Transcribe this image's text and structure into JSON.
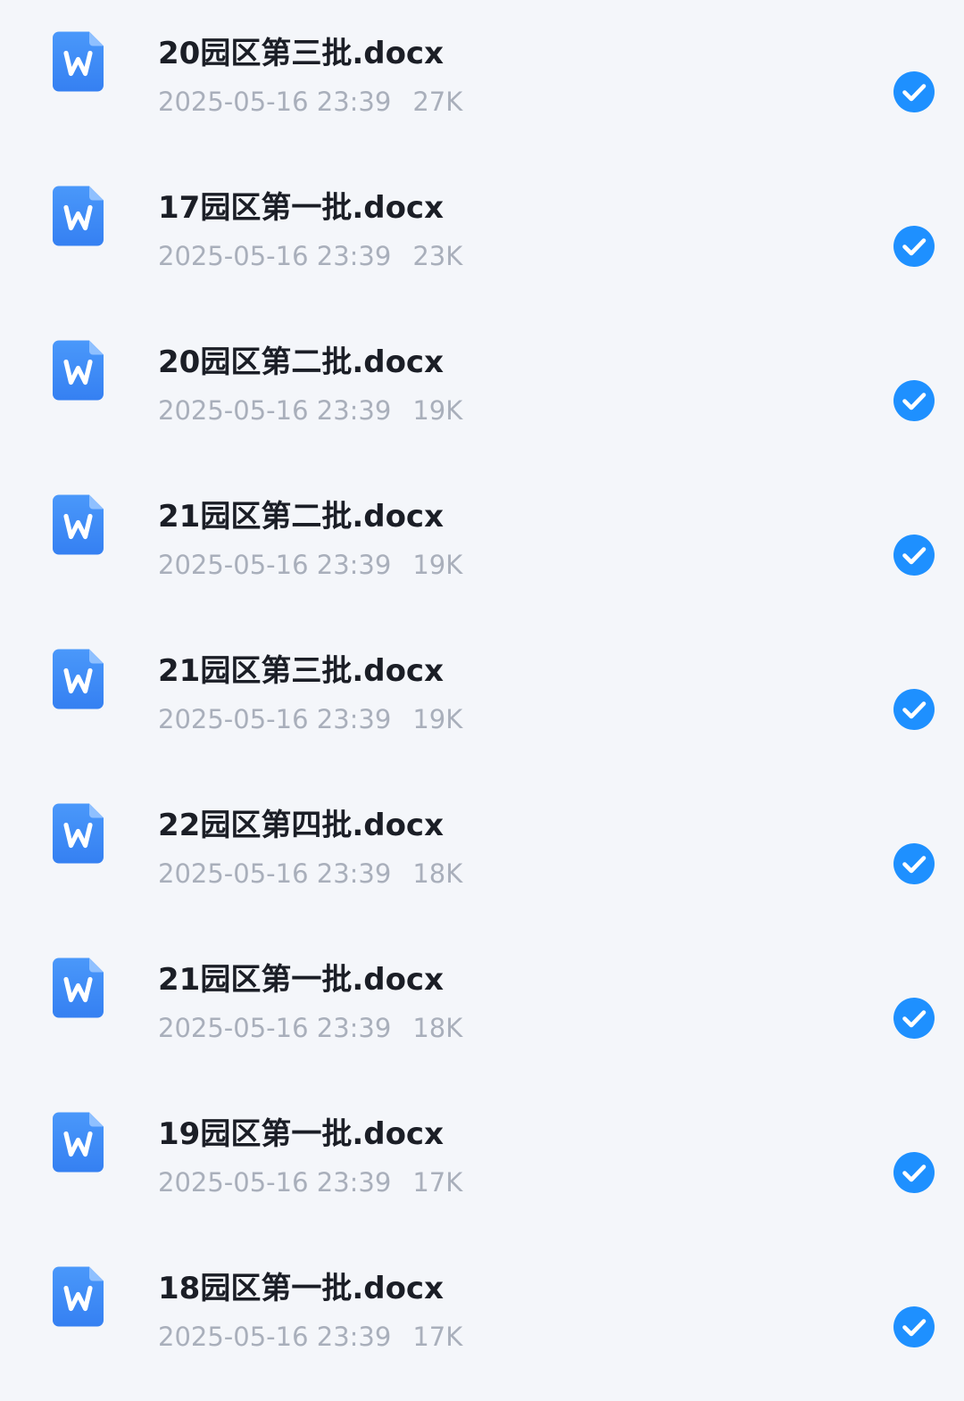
{
  "colors": {
    "background": "#F4F6FA",
    "icon_blue": "#3F8EF8",
    "check_blue": "#1E90FF",
    "name_text": "#1B1E26",
    "meta_text": "#A9AFBB"
  },
  "files": [
    {
      "name": "20园区第三批.docx",
      "date": "2025-05-16 23:39",
      "size": "27K",
      "icon": "word-doc-icon",
      "selected": true
    },
    {
      "name": "17园区第一批.docx",
      "date": "2025-05-16 23:39",
      "size": "23K",
      "icon": "word-doc-icon",
      "selected": true
    },
    {
      "name": "20园区第二批.docx",
      "date": "2025-05-16 23:39",
      "size": "19K",
      "icon": "word-doc-icon",
      "selected": true
    },
    {
      "name": "21园区第二批.docx",
      "date": "2025-05-16 23:39",
      "size": "19K",
      "icon": "word-doc-icon",
      "selected": true
    },
    {
      "name": "21园区第三批.docx",
      "date": "2025-05-16 23:39",
      "size": "19K",
      "icon": "word-doc-icon",
      "selected": true
    },
    {
      "name": "22园区第四批.docx",
      "date": "2025-05-16 23:39",
      "size": "18K",
      "icon": "word-doc-icon",
      "selected": true
    },
    {
      "name": "21园区第一批.docx",
      "date": "2025-05-16 23:39",
      "size": "18K",
      "icon": "word-doc-icon",
      "selected": true
    },
    {
      "name": "19园区第一批.docx",
      "date": "2025-05-16 23:39",
      "size": "17K",
      "icon": "word-doc-icon",
      "selected": true
    },
    {
      "name": "18园区第一批.docx",
      "date": "2025-05-16 23:39",
      "size": "17K",
      "icon": "word-doc-icon",
      "selected": true
    }
  ]
}
